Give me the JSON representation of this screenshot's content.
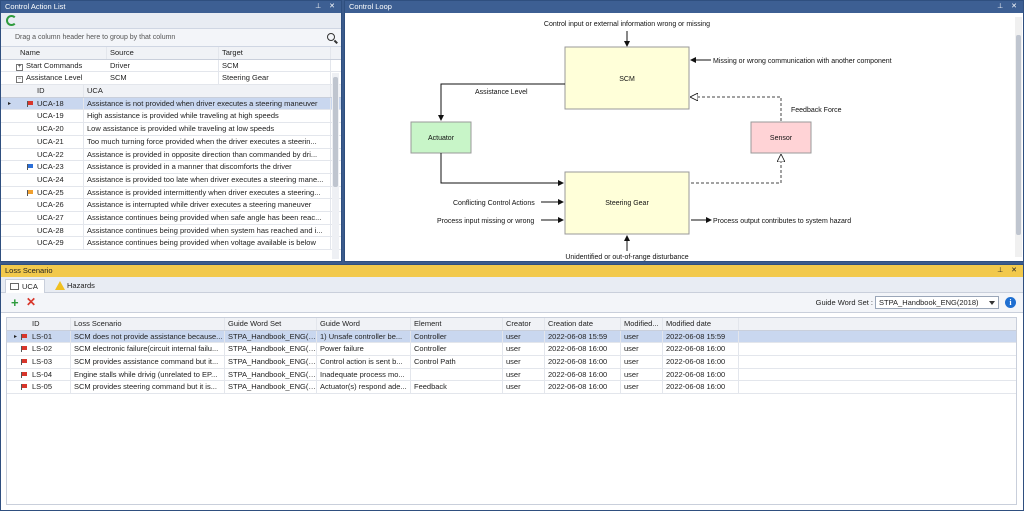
{
  "control_action_list": {
    "title": "Control Action List",
    "group_hint": "Drag a column header here to group by that column",
    "columns": [
      "Name",
      "Source",
      "Target"
    ],
    "rows": [
      {
        "expander": "+",
        "name": "Start Commands",
        "source": "Driver",
        "target": "SCM"
      },
      {
        "expander": "−",
        "name": "Assistance Level",
        "source": "SCM",
        "target": "Steering Gear"
      }
    ],
    "sub_columns": [
      "ID",
      "UCA"
    ],
    "uca_rows": [
      {
        "id": "UCA-18",
        "uca": "Assistance is not provided when driver executes a steering maneuver",
        "flag": "red",
        "selected": true
      },
      {
        "id": "UCA-19",
        "uca": "High assistance is provided while traveling at high speeds",
        "flag": ""
      },
      {
        "id": "UCA-20",
        "uca": "Low assistance is provided while traveling at low speeds",
        "flag": ""
      },
      {
        "id": "UCA-21",
        "uca": "Too much turning force provided when the driver executes a steerin...",
        "flag": ""
      },
      {
        "id": "UCA-22",
        "uca": "Assistance is provided in opposite direction than commanded by dri...",
        "flag": ""
      },
      {
        "id": "UCA-23",
        "uca": "Assistance is provided in a manner that discomforts the driver",
        "flag": "blue"
      },
      {
        "id": "UCA-24",
        "uca": "Assistance is provided too late when driver executes a steering mane...",
        "flag": ""
      },
      {
        "id": "UCA-25",
        "uca": "Assistance is provided intermittently when driver executes a steering...",
        "flag": "orange"
      },
      {
        "id": "UCA-26",
        "uca": "Assistance is interrupted while driver executes a steering maneuver",
        "flag": ""
      },
      {
        "id": "UCA-27",
        "uca": "Assistance continues being provided when safe angle has been reac...",
        "flag": ""
      },
      {
        "id": "UCA-28",
        "uca": "Assistance continues being provided when system has reached and i...",
        "flag": ""
      },
      {
        "id": "UCA-29",
        "uca": "Assistance continues being provided when voltage available is below",
        "flag": ""
      }
    ]
  },
  "control_loop": {
    "title": "Control Loop",
    "nodes": {
      "scm": "SCM",
      "actuator": "Actuator",
      "sensor": "Sensor",
      "steering_gear": "Steering Gear"
    },
    "labels": {
      "top": "Control input or external information wrong or missing",
      "missing_comm": "Missing or wrong communication with another component",
      "assistance_level": "Assistance Level",
      "feedback_force": "Feedback Force",
      "conflicting": "Conflicting Control Actions",
      "process_input": "Process input missing or wrong",
      "process_output": "Process output contributes to system hazard",
      "disturbance": "Unidentified or out-of-range disturbance"
    }
  },
  "loss_scenario": {
    "title": "Loss Scenario",
    "tabs": [
      "UCA",
      "Hazards"
    ],
    "guide_word_set_label": "Guide Word Set :",
    "guide_word_set_value": "STPA_Handbook_ENG(2018)",
    "columns": [
      "ID",
      "Loss Scenario",
      "Guide Word Set",
      "Guide Word",
      "Element",
      "Creator",
      "Creation date",
      "Modified...",
      "Modified date"
    ],
    "rows": [
      {
        "id": "LS-01",
        "scenario": "SCM does not provide assistance because...",
        "gws": "STPA_Handbook_ENG(2...",
        "gw": "1) Unsafe controller be...",
        "element": "Controller",
        "creator": "user",
        "created": "2022-06-08 15:59",
        "modby": "user",
        "modified": "2022-06-08 15:59",
        "selected": true
      },
      {
        "id": "LS-02",
        "scenario": "SCM electronic failure(circuit internal failu...",
        "gws": "STPA_Handbook_ENG(2...",
        "gw": "Power failure",
        "element": "Controller",
        "creator": "user",
        "created": "2022-06-08 16:00",
        "modby": "user",
        "modified": "2022-06-08 16:00"
      },
      {
        "id": "LS-03",
        "scenario": "SCM provides assistance command but it...",
        "gws": "STPA_Handbook_ENG(2...",
        "gw": "Control action is sent b...",
        "element": "Control Path",
        "creator": "user",
        "created": "2022-06-08 16:00",
        "modby": "user",
        "modified": "2022-06-08 16:00"
      },
      {
        "id": "LS-04",
        "scenario": "Engine stalls while drivig (unrelated to EP...",
        "gws": "STPA_Handbook_ENG(2...",
        "gw": "Inadequate process mo...",
        "element": "",
        "creator": "user",
        "created": "2022-06-08 16:00",
        "modby": "user",
        "modified": "2022-06-08 16:00"
      },
      {
        "id": "LS-05",
        "scenario": "SCM provides steering command but it is...",
        "gws": "STPA_Handbook_ENG(2...",
        "gw": "Actuator(s) respond ade...",
        "element": "Feedback",
        "creator": "user",
        "created": "2022-06-08 16:00",
        "modby": "user",
        "modified": "2022-06-08 16:00"
      }
    ]
  }
}
